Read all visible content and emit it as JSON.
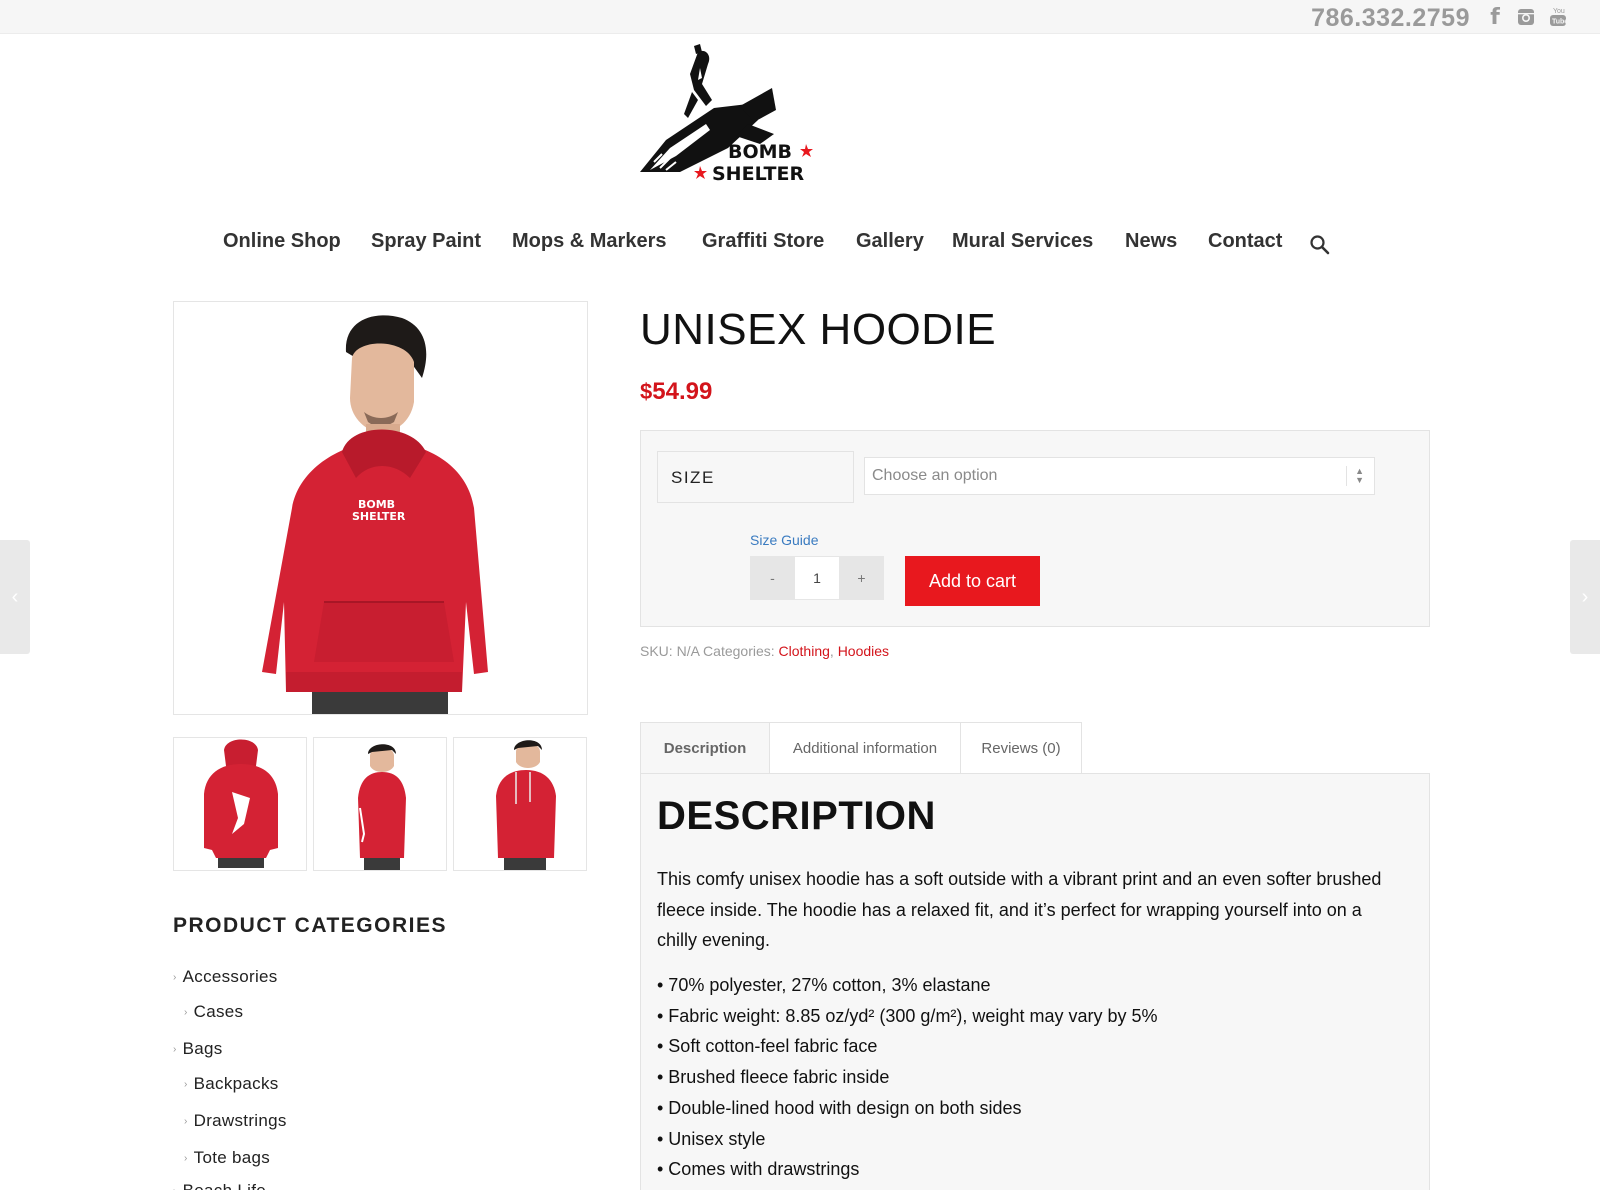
{
  "topbar": {
    "phone": "786.332.2759",
    "social_icons": [
      "facebook-icon",
      "instagram-icon",
      "youtube-icon"
    ]
  },
  "logo": {
    "alt": "Bomb Shelter logo",
    "line1": "BOMB",
    "line2": "SHELTER"
  },
  "nav": {
    "items": [
      "Online Shop",
      "Spray Paint",
      "Mops & Markers",
      "Graffiti Store",
      "Gallery",
      "Mural Services",
      "News",
      "Contact"
    ],
    "search_icon": "search-icon"
  },
  "product": {
    "title": "UNISEX HOODIE",
    "currency": "$",
    "price": "54.99",
    "size_label": "SIZE",
    "size_placeholder": "Choose an option",
    "size_guide": "Size Guide",
    "qty_minus": "-",
    "qty_value": "1",
    "qty_plus": "+",
    "add_to_cart": "Add to cart",
    "sku_label": "SKU:",
    "sku_value": "N/A",
    "categories_label": "Categories:",
    "category_links": [
      "Clothing",
      "Hoodies"
    ],
    "image_print_line1": "BOMB",
    "image_print_line2": "SHELTER"
  },
  "tabs": [
    {
      "label": "Description",
      "active": true
    },
    {
      "label": "Additional information",
      "active": false
    },
    {
      "label": "Reviews (0)",
      "active": false
    }
  ],
  "description": {
    "heading": "DESCRIPTION",
    "text": "This comfy unisex hoodie has a soft outside with a vibrant print and an even softer brushed fleece inside. The hoodie has a relaxed fit, and it’s perfect for wrapping yourself into on a chilly evening.",
    "bullets": [
      "• 70% polyester, 27% cotton, 3% elastane",
      "• Fabric weight: 8.85 oz/yd² (300 g/m²), weight may vary by 5%",
      "• Soft cotton-feel fabric face",
      "• Brushed fleece fabric inside",
      "• Double-lined hood with design on both sides",
      "• Unisex style",
      "• Comes with drawstrings"
    ]
  },
  "sidebar": {
    "title": "PRODUCT CATEGORIES",
    "categories": [
      "Accessories",
      "Cases",
      "Bags",
      "Backpacks",
      "Drawstrings",
      "Tote bags",
      "Beach Life"
    ]
  },
  "colors": {
    "brand_red": "#e8181e",
    "price_red": "#d3141b",
    "link_blue": "#3a7bc0"
  }
}
